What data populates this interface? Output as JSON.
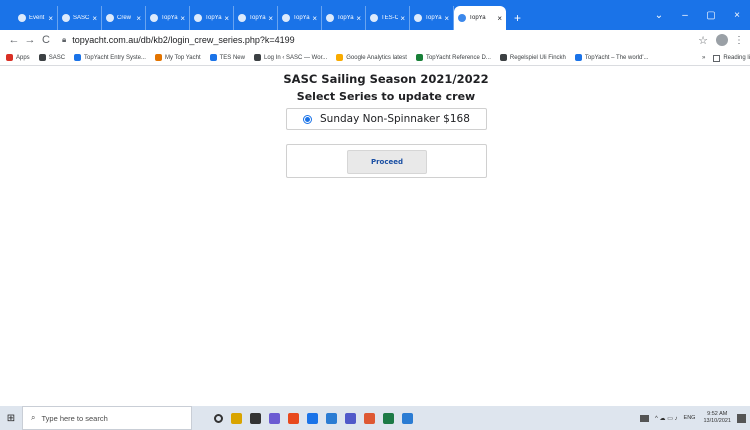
{
  "browser": {
    "tabs": [
      {
        "title": "Event",
        "active": false
      },
      {
        "title": "SASC",
        "active": false
      },
      {
        "title": "Crew",
        "active": false
      },
      {
        "title": "TopYa",
        "active": false
      },
      {
        "title": "TopYa",
        "active": false
      },
      {
        "title": "TopYa",
        "active": false
      },
      {
        "title": "TopYa",
        "active": false
      },
      {
        "title": "TopYa",
        "active": false
      },
      {
        "title": "TES-Cr",
        "active": false
      },
      {
        "title": "TopYa",
        "active": false
      },
      {
        "title": "TopYa",
        "active": true
      }
    ],
    "tab_close_glyph": "×",
    "new_tab_glyph": "+",
    "window_controls": {
      "chevron": "⌄",
      "minimize": "–",
      "maximize": "▢",
      "close": "×"
    },
    "url": "topyacht.com.au/db/kb2/login_crew_series.php?k=4199",
    "nav": {
      "back": "←",
      "forward": "→",
      "reload": "C"
    },
    "bookmarks": [
      {
        "label": "Apps",
        "color": "#d93025"
      },
      {
        "label": "SASC",
        "color": "#3c4043"
      },
      {
        "label": "TopYacht Entry Syste...",
        "color": "#1a73e8"
      },
      {
        "label": "My Top Yacht",
        "color": "#e37400"
      },
      {
        "label": "TES New",
        "color": "#1a73e8"
      },
      {
        "label": "Log In ‹ SASC — Wor...",
        "color": "#3c4043"
      },
      {
        "label": "Google Analytics latest",
        "color": "#f9ab00"
      },
      {
        "label": "TopYacht Reference D...",
        "color": "#188038"
      },
      {
        "label": "Regelspiel Uli Finckh",
        "color": "#3c4043"
      },
      {
        "label": "TopYacht – The world'...",
        "color": "#1a73e8"
      }
    ],
    "bookmarks_overflow": "»",
    "reading_list": "Reading li"
  },
  "page": {
    "title": "SASC Sailing Season 2021/2022",
    "subtitle": "Select Series to update crew",
    "series_option": "Sunday Non-Spinnaker $168",
    "proceed_label": "Proceed"
  },
  "taskbar": {
    "search_placeholder": "Type here to search",
    "language": "ENG",
    "time": "9:52 AM",
    "date": "13/10/2021",
    "app_colors": [
      "#555555",
      "#d9a400",
      "#333333",
      "#6b5bd2",
      "#e8491d",
      "#1a73e8",
      "#2b7cd3",
      "#5059c9",
      "#de5833",
      "#1d7a46",
      "#2b7cd3"
    ]
  }
}
